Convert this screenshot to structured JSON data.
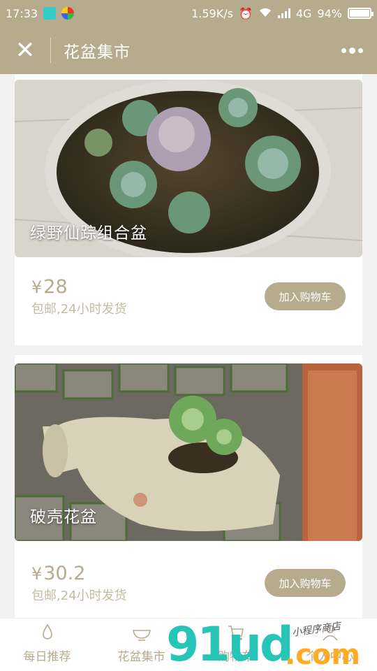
{
  "status_bar": {
    "time": "17:33",
    "network_speed": "1.59K/s",
    "network_type": "4G",
    "battery": "94%",
    "battery_level": 0.94
  },
  "nav": {
    "close_icon": "close-icon",
    "title": "花盆集市",
    "more_icon": "more-dots-icon"
  },
  "products": [
    {
      "title": "绿野仙踪组合盆",
      "currency": "¥",
      "price": "28",
      "shipping": "包邮,24小时发货",
      "cart_label": "加入购物车"
    },
    {
      "title": "破壳花盆",
      "currency": "¥",
      "price": "30.2",
      "shipping": "包邮,24小时发货",
      "cart_label": "加入购物车"
    }
  ],
  "tabs": [
    {
      "label": "每日推荐",
      "icon": "drop-icon"
    },
    {
      "label": "花盆集市",
      "icon": "bowl-icon"
    },
    {
      "label": "购物车",
      "icon": "cart-icon"
    },
    {
      "label": "个人中心",
      "icon": "user-icon"
    }
  ],
  "watermark": {
    "main": "91ud",
    "suffix": ".com",
    "tagline": "小程序商店"
  },
  "colors": {
    "accent": "#b6ab8c",
    "text_light": "#c3bba3",
    "background": "#f2f2f2"
  }
}
